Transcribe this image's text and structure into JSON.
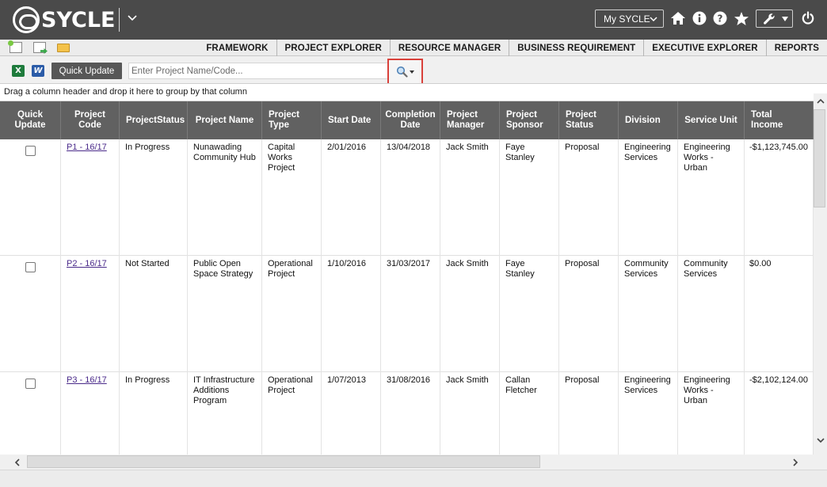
{
  "app": {
    "logo_text": "SYCLE"
  },
  "header": {
    "my_sycle_label": "My SYCLE",
    "icons": [
      "home-icon",
      "info-icon",
      "help-icon",
      "star-icon",
      "wrench-icon",
      "power-icon"
    ]
  },
  "menu": {
    "items": [
      {
        "label": "FRAMEWORK"
      },
      {
        "label": "PROJECT EXPLORER"
      },
      {
        "label": "RESOURCE MANAGER"
      },
      {
        "label": "BUSINESS REQUIREMENT"
      },
      {
        "label": "EXECUTIVE EXPLORER"
      },
      {
        "label": "REPORTS"
      }
    ]
  },
  "toolbar": {
    "quick_update_label": "Quick Update",
    "search_placeholder": "Enter Project Name/Code...",
    "search_value": ""
  },
  "grid": {
    "group_hint": "Drag a column header and drop it here to group by that column",
    "columns": [
      {
        "label": "Quick Update"
      },
      {
        "label": "Project Code"
      },
      {
        "label": "ProjectStatus"
      },
      {
        "label": "Project Name"
      },
      {
        "label": "Project Type"
      },
      {
        "label": "Start Date"
      },
      {
        "label": "Completion Date"
      },
      {
        "label": "Project Manager"
      },
      {
        "label": "Project Sponsor"
      },
      {
        "label": "Project Status"
      },
      {
        "label": "Division"
      },
      {
        "label": "Service Unit"
      },
      {
        "label": "Total Income"
      }
    ],
    "rows": [
      {
        "code": "P1 - 16/17",
        "status": "In Progress",
        "name": "Nunawading Community Hub",
        "type": "Capital Works Project",
        "start": "2/01/2016",
        "completion": "13/04/2018",
        "manager": "Jack Smith",
        "sponsor": "Faye Stanley",
        "project_status": "Proposal",
        "division": "Engineering Services",
        "service_unit": "Engineering Works - Urban",
        "total_income": "-$1,123,745.00"
      },
      {
        "code": "P2 - 16/17",
        "status": "Not Started",
        "name": "Public Open Space Strategy",
        "type": "Operational Project",
        "start": "1/10/2016",
        "completion": "31/03/2017",
        "manager": "Jack Smith",
        "sponsor": "Faye Stanley",
        "project_status": "Proposal",
        "division": "Community Services",
        "service_unit": "Community Services",
        "total_income": "$0.00"
      },
      {
        "code": "P3 - 16/17",
        "status": "In Progress",
        "name": "IT Infrastructure Additions Program",
        "type": "Operational Project",
        "start": "1/07/2013",
        "completion": "31/08/2016",
        "manager": "Jack Smith",
        "sponsor": "Callan Fletcher",
        "project_status": "Proposal",
        "division": "Engineering Services",
        "service_unit": "Engineering Works - Urban",
        "total_income": "-$2,102,124.00"
      }
    ]
  }
}
